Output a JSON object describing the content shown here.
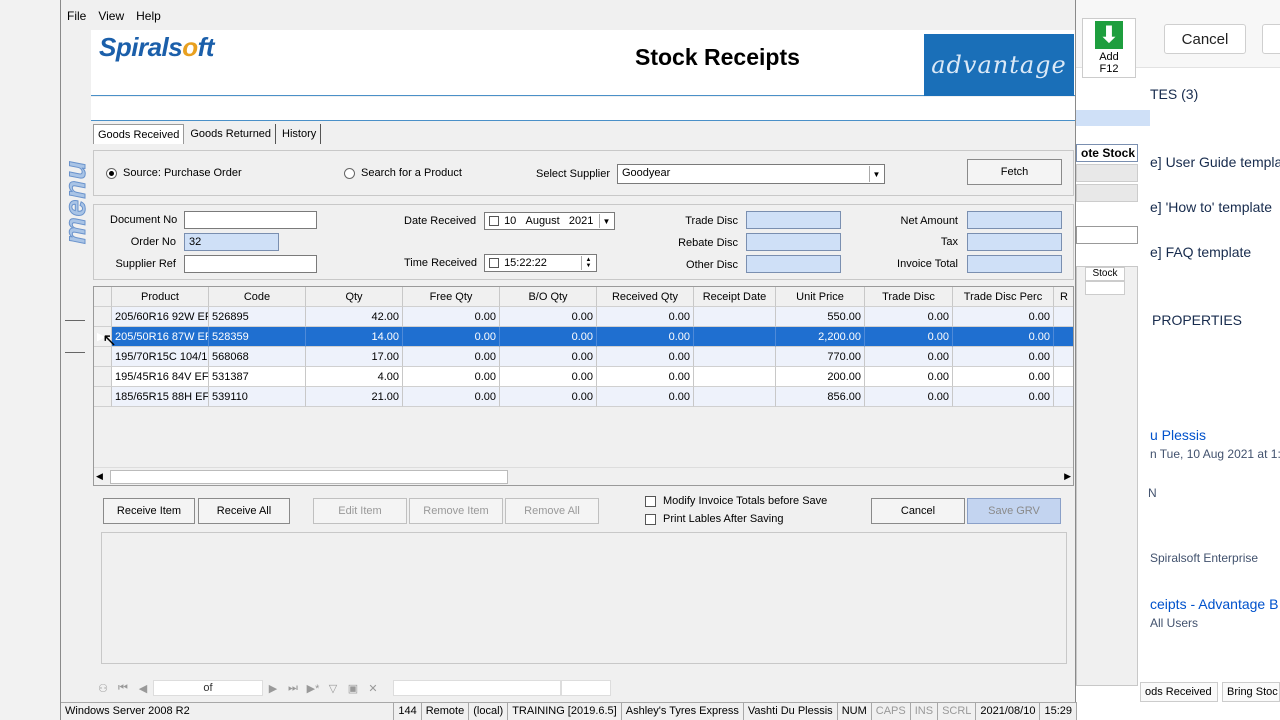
{
  "menu": {
    "file": "File",
    "view": "View",
    "help": "Help"
  },
  "side_menu_label": "menu",
  "header": {
    "logo_part1": "Spirals",
    "logo_o": "o",
    "logo_part2": "ft",
    "title": "Stock Receipts",
    "adv_logo": "advantage"
  },
  "tabs": [
    "Goods Received",
    "Goods Returned",
    "History"
  ],
  "source": {
    "purchase_order": "Source: Purchase Order",
    "search_product": "Search for a Product",
    "select_supplier": "Select Supplier",
    "supplier_value": "Goodyear",
    "fetch": "Fetch"
  },
  "doc": {
    "document_no": "Document No",
    "order_no": "Order No",
    "order_no_value": "32",
    "supplier_ref": "Supplier Ref",
    "date_received": "Date Received",
    "date_day": "10",
    "date_month": "August",
    "date_year": "2021",
    "time_received": "Time Received",
    "time_value": "15:22:22",
    "trade_disc": "Trade Disc",
    "rebate_disc": "Rebate Disc",
    "other_disc": "Other Disc",
    "net_amount": "Net Amount",
    "tax": "Tax",
    "invoice_total": "Invoice Total"
  },
  "grid": {
    "columns": [
      "Product",
      "Code",
      "Qty",
      "Free Qty",
      "B/O Qty",
      "Received Qty",
      "Receipt Date",
      "Unit Price",
      "Trade Disc",
      "Trade Disc Perc",
      "R"
    ],
    "rows": [
      [
        "205/60R16 92W EF",
        "526895",
        "42.00",
        "0.00",
        "0.00",
        "0.00",
        "",
        "550.00",
        "0.00",
        "0.00",
        ""
      ],
      [
        "205/50R16 87W EF",
        "528359",
        "14.00",
        "0.00",
        "0.00",
        "0.00",
        "",
        "2,200.00",
        "0.00",
        "0.00",
        ""
      ],
      [
        "195/70R15C 104/1(",
        "568068",
        "17.00",
        "0.00",
        "0.00",
        "0.00",
        "",
        "770.00",
        "0.00",
        "0.00",
        ""
      ],
      [
        "195/45R16 84V EFI",
        "531387",
        "4.00",
        "0.00",
        "0.00",
        "0.00",
        "",
        "200.00",
        "0.00",
        "0.00",
        ""
      ],
      [
        "185/65R15 88H EFI",
        "539110",
        "21.00",
        "0.00",
        "0.00",
        "0.00",
        "",
        "856.00",
        "0.00",
        "0.00",
        ""
      ]
    ],
    "selected_row": 1
  },
  "actions": {
    "receive_item": "Receive Item",
    "receive_all": "Receive All",
    "edit_item": "Edit Item",
    "remove_item": "Remove Item",
    "remove_all": "Remove All",
    "modify_totals": "Modify Invoice Totals before Save",
    "print_labels": "Print Lables After Saving",
    "cancel": "Cancel",
    "save_grv": "Save GRV"
  },
  "nav": {
    "of": "of"
  },
  "status": [
    "Windows Server 2008 R2",
    "144",
    "Remote",
    "(local)",
    "TRAINING [2019.6.5]",
    "Ashley's Tyres Express",
    "Vashti Du Plessis",
    "NUM",
    "CAPS",
    "INS",
    "SCRL",
    "2021/08/10",
    "15:29"
  ],
  "bg": {
    "cancel": "Cancel",
    "add_label": "Add",
    "add_key": "F12",
    "tes": "TES (3)",
    "note_stock": "ote Stock",
    "stock_col": "Stock",
    "user_guide": "e] User Guide templa",
    "how_to": "e] 'How to' template",
    "faq": "e] FAQ template",
    "properties": "PROPERTIES",
    "author": "u Plessis",
    "date": "n Tue, 10 Aug 2021 at 1:5",
    "n": "N",
    "enterprise": "Spiralsoft Enterprise",
    "receipts": "ceipts - Advantage B",
    "all_users": "All Users",
    "goods_received_btn": "ods Received",
    "bring_stock_btn": "Bring Stoc"
  }
}
